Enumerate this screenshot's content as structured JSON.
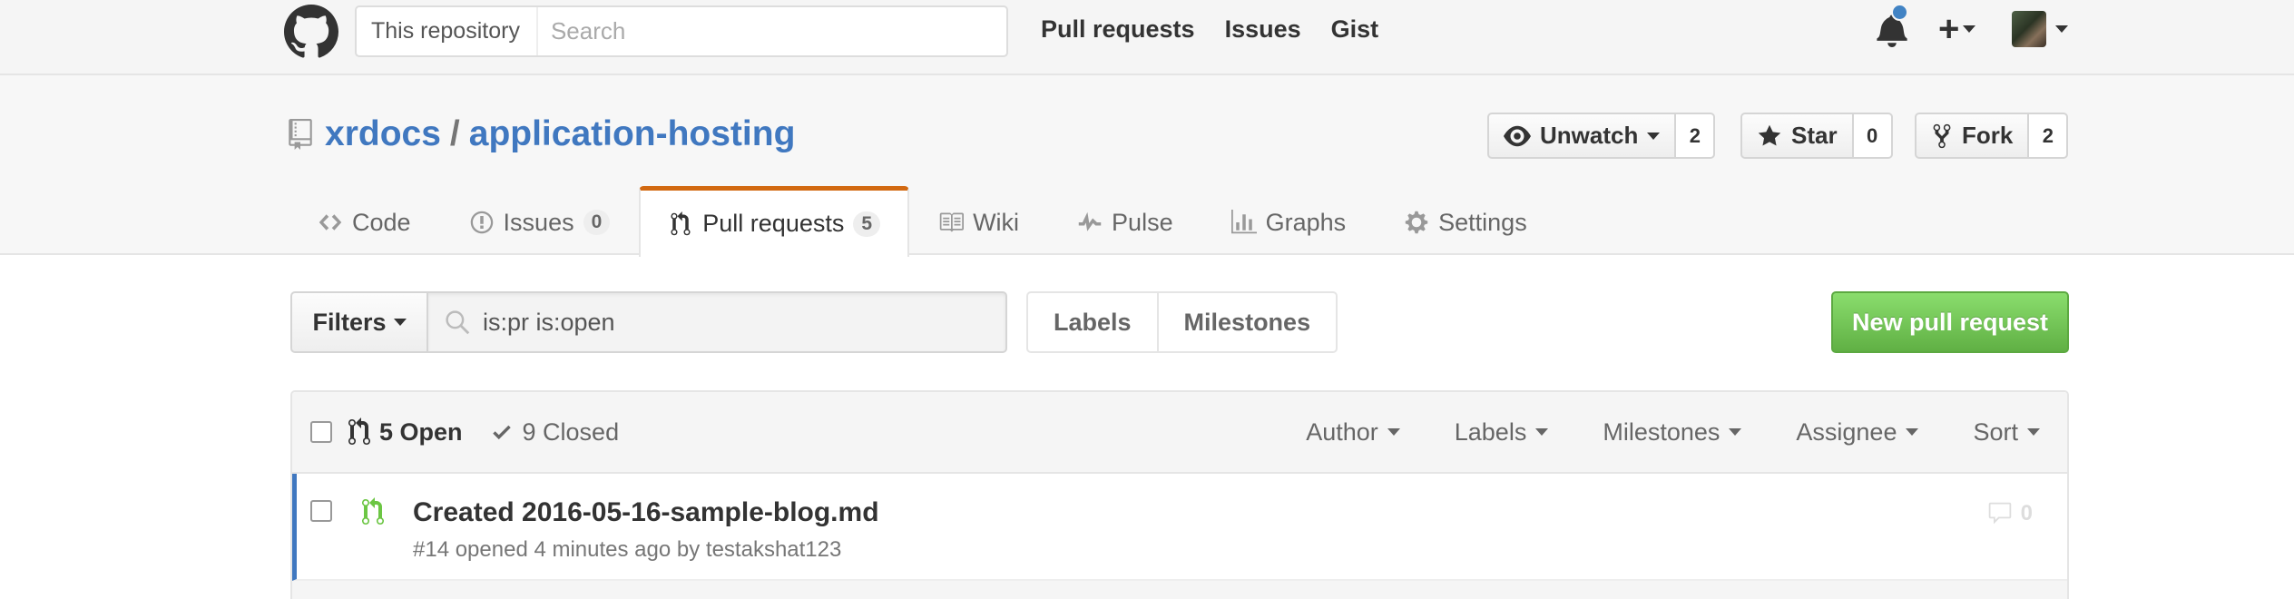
{
  "header": {
    "scope_label": "This repository",
    "search_placeholder": "Search",
    "nav": [
      "Pull requests",
      "Issues",
      "Gist"
    ]
  },
  "repo": {
    "owner": "xrdocs",
    "separator": "/",
    "name": "application-hosting",
    "watch": {
      "label": "Unwatch",
      "count": "2"
    },
    "star": {
      "label": "Star",
      "count": "0"
    },
    "fork": {
      "label": "Fork",
      "count": "2"
    }
  },
  "reponav": {
    "code": "Code",
    "issues": {
      "label": "Issues",
      "count": "0"
    },
    "pulls": {
      "label": "Pull requests",
      "count": "5"
    },
    "wiki": "Wiki",
    "pulse": "Pulse",
    "graphs": "Graphs",
    "settings": "Settings"
  },
  "subnav": {
    "filters_label": "Filters",
    "filter_value": "is:pr is:open",
    "labels": "Labels",
    "milestones": "Milestones",
    "new_pr": "New pull request"
  },
  "list_header": {
    "open": "5 Open",
    "closed": "9 Closed",
    "filters": [
      "Author",
      "Labels",
      "Milestones",
      "Assignee",
      "Sort"
    ]
  },
  "pull_requests": [
    {
      "title": "Created 2016-05-16-sample-blog.md",
      "meta": "#14 opened 4 minutes ago by testakshat123",
      "comments": "0"
    }
  ],
  "colors": {
    "link": "#4078c0",
    "selected_tab": "#d26911",
    "primary_button": "#6cc644",
    "notification": "#4183c4"
  }
}
